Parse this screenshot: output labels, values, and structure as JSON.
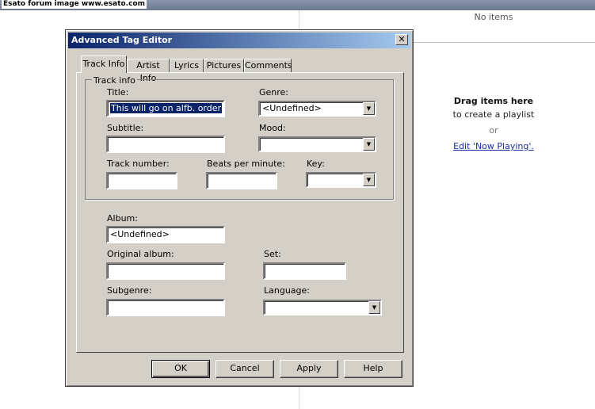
{
  "background": {
    "watermark": "Esato forum image www.esato.com",
    "playlist": {
      "no_items": "No items",
      "drag_here": "Drag items here",
      "create_playlist": "to create a playlist",
      "or": "or",
      "edit_now_playing": "Edit 'Now Playing'."
    }
  },
  "dialog": {
    "title": "Advanced Tag Editor",
    "close_glyph": "✕",
    "tabs": [
      {
        "label": "Track Info",
        "active": true
      },
      {
        "label": "Artist Info",
        "active": false
      },
      {
        "label": "Lyrics",
        "active": false
      },
      {
        "label": "Pictures",
        "active": false
      },
      {
        "label": "Comments",
        "active": false
      }
    ],
    "track_info": {
      "group_label": "Track info",
      "title_label": "Title:",
      "title_value": "This will go on alfb. order",
      "genre_label": "Genre:",
      "genre_value": "<Undefined>",
      "subtitle_label": "Subtitle:",
      "subtitle_value": "",
      "mood_label": "Mood:",
      "mood_value": "",
      "track_number_label": "Track number:",
      "track_number_value": "",
      "bpm_label": "Beats per minute:",
      "bpm_value": "",
      "key_label": "Key:",
      "key_value": ""
    },
    "album_info": {
      "album_label": "Album:",
      "album_value": "<Undefined>",
      "original_album_label": "Original album:",
      "original_album_value": "",
      "set_label": "Set:",
      "set_value": "",
      "subgenre_label": "Subgenre:",
      "subgenre_value": "",
      "language_label": "Language:",
      "language_value": ""
    },
    "buttons": {
      "ok": "OK",
      "cancel": "Cancel",
      "apply": "Apply",
      "help": "Help"
    },
    "dropdown_arrow": "▼"
  }
}
